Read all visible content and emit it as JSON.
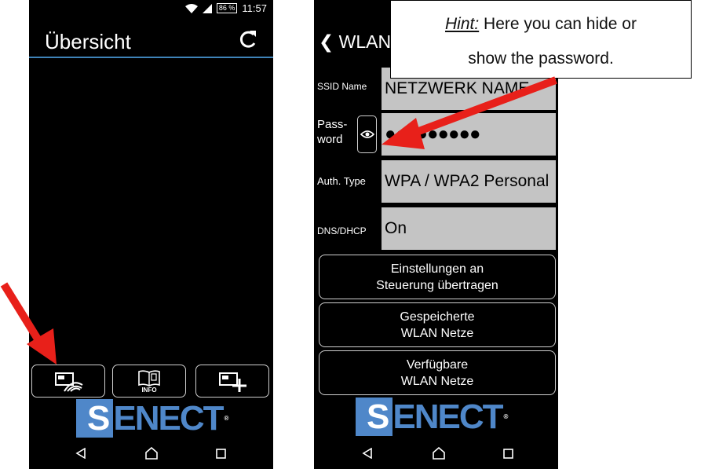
{
  "left_screen": {
    "status": {
      "battery": "86 %",
      "time": "11:57"
    },
    "title": "Übersicht",
    "bottom_buttons": {
      "info_label": "INFO"
    },
    "logo": {
      "s": "S",
      "rest": "ENECT",
      "reg": "®"
    }
  },
  "right_screen": {
    "title": "WLAN",
    "fields": [
      {
        "label": "SSID Name",
        "value": "NETZWERK NAME"
      },
      {
        "label": "Pass-",
        "label2": "word",
        "value": "●●●●●●●●●"
      },
      {
        "label": "Auth. Type",
        "value": "WPA / WPA2 Personal"
      },
      {
        "label": "DNS/DHCP",
        "value": "On"
      }
    ],
    "buttons": [
      {
        "line1": "Einstellungen an",
        "line2": "Steuerung übertragen"
      },
      {
        "line1": "Gespeicherte",
        "line2": "WLAN Netze"
      },
      {
        "line1": "Verfügbare",
        "line2": "WLAN Netze"
      }
    ],
    "logo": {
      "s": "S",
      "rest": "ENECT",
      "reg": "®"
    }
  },
  "hint": {
    "label": "Hint:",
    "line1_text": " Here you can hide or",
    "line2_text": "show the password."
  },
  "colors": {
    "accent": "#4f87c9",
    "arrow": "#e8201a",
    "divider": "#3f83b8",
    "field_bg": "#c4c4c4"
  }
}
